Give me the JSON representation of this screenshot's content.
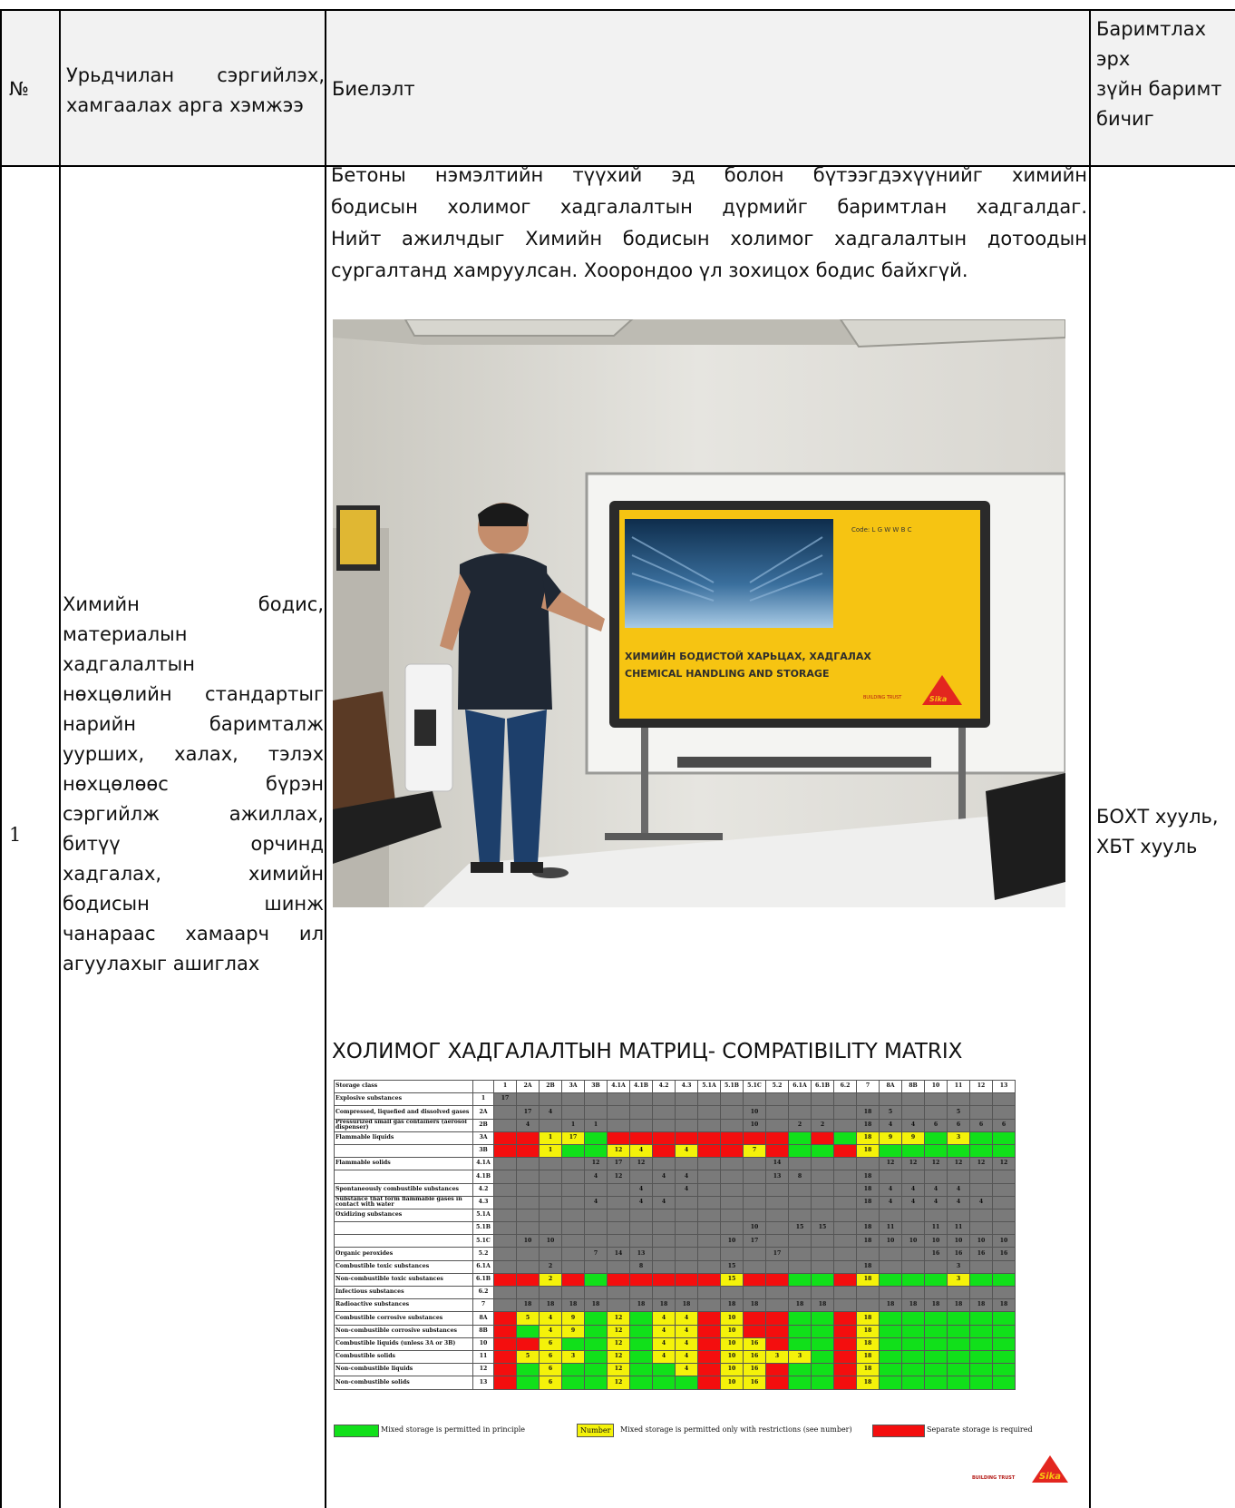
{
  "header": {
    "no": "№",
    "measure": "Урьдчилан сэргийлэх, хамгаалах арга хэмжээ",
    "implementation": "Биелэлт",
    "document_lines": [
      "Баримтлах",
      "эрх",
      "зүйн баримт",
      "бичиг"
    ]
  },
  "row": {
    "no": "1",
    "measure_lines": [
      "Химийн бодис,",
      "материалын",
      "хадгалалтын",
      "нөхцөлийн стандартыг",
      "нарийн баримталж",
      "ууршиx, халах, тэлэх",
      "нөхцөлөөс бүрэн",
      "сэргийлж ажиллах,",
      "битүү орчинд",
      "хадгалах, химийн",
      "бодисын шинж",
      "чанараас хамаарч ил",
      "агуулахыг ашиглах"
    ],
    "implementation_lines": [
      "Бетоны нэмэлтийн түүхий эд болон бүтээгдэхүүнийг химийн",
      "бодисын холимог хадгалалтын дүрмийг баримтлан хадгалдаг.",
      "Нийт ажилчдыг Химийн бодисын холимог хадгалалтын дотоодын",
      "сургалтанд хамруулсан. Хоорондоо үл зохицох бодис байхгүй."
    ],
    "document_lines": [
      "БОХТ хууль,",
      "ХБТ хууль"
    ]
  },
  "photo": {
    "screen_code": "Code: L G W W B C",
    "screen_title_mn": "ХИМИЙН БОДИСТОЙ ХАРЬЦАХ, ХАДГАЛАХ",
    "screen_title_en": "CHEMICAL HANDLING AND STORAGE",
    "screen_brand": "BUILDING TRUST",
    "logo": "Sika"
  },
  "matrix": {
    "caption": "ХОЛИМОГ ХАДГАЛАЛТЫН МАТРИЦ- COMPATIBILITY MATRIX",
    "corner": "Storage class",
    "columns": [
      "1",
      "2A",
      "2B",
      "3A",
      "3B",
      "4.1A",
      "4.1B",
      "4.2",
      "4.3",
      "5.1A",
      "5.1B",
      "5.1C",
      "5.2",
      "6.1A",
      "6.1B",
      "6.2",
      "7",
      "8A",
      "8B",
      "10",
      "11",
      "12",
      "13"
    ],
    "rows": [
      {
        "label": "Explosive substances",
        "cls": "1",
        "cells": [
          "g:17",
          "g",
          "g",
          "g",
          "g",
          "g",
          "g",
          "g",
          "g",
          "g",
          "g",
          "g",
          "g",
          "g",
          "g",
          "g",
          "g",
          "g",
          "g",
          "g",
          "g",
          "g",
          "g"
        ]
      },
      {
        "label": "Compressed, liquefied and dissolved gases",
        "cls": "2A",
        "cells": [
          "g",
          "g:17",
          "g:4",
          "g",
          "g",
          "g",
          "g",
          "g",
          "g",
          "g",
          "g",
          "g:10",
          "g",
          "g",
          "g",
          "g",
          "g:18",
          "g:5",
          "g",
          "g",
          "g:5",
          "g",
          "g"
        ]
      },
      {
        "label": "Pressurized small gas containers (aerosol dispenser)",
        "cls": "2B",
        "cells": [
          "g",
          "g:4",
          "g",
          "g:1",
          "g:1",
          "g",
          "g",
          "g",
          "g",
          "g",
          "g",
          "g:10",
          "g",
          "g:2",
          "g:2",
          "g",
          "g:18",
          "g:4",
          "g:4",
          "g:6",
          "g:6",
          "g:6",
          "g:6"
        ]
      },
      {
        "label": "Flammable liquids",
        "cls": "3A",
        "cells": [
          "re",
          "re",
          "ye:1",
          "ye:17",
          "gr",
          "re",
          "re",
          "re",
          "re",
          "re",
          "re",
          "re",
          "re",
          "gr",
          "re",
          "gr",
          "ye:18",
          "ye:9",
          "ye:9",
          "gr",
          "ye:3",
          "gr",
          "gr"
        ]
      },
      {
        "label": "",
        "cls": "3B",
        "cells": [
          "re",
          "re",
          "ye:1",
          "gr",
          "gr",
          "ye:12",
          "ye:4",
          "re",
          "ye:4",
          "re",
          "re",
          "ye:7",
          "re",
          "gr",
          "gr",
          "re",
          "ye:18",
          "gr",
          "gr",
          "gr",
          "gr",
          "gr",
          "gr"
        ]
      },
      {
        "label": "Flammable solids",
        "cls": "4.1A",
        "cells": [
          "g",
          "g",
          "g",
          "g",
          "g:12",
          "g:17",
          "g:12",
          "g",
          "g",
          "g",
          "g",
          "g",
          "g:14",
          "g",
          "g",
          "g",
          "g",
          "g:12",
          "g:12",
          "g:12",
          "g:12",
          "g:12",
          "g:12"
        ]
      },
      {
        "label": "",
        "cls": "4.1B",
        "cells": [
          "g",
          "g",
          "g",
          "g",
          "g:4",
          "g:12",
          "g",
          "g:4",
          "g:4",
          "g",
          "g",
          "g",
          "g:13",
          "g:8",
          "g",
          "g",
          "g:18",
          "g",
          "g",
          "g",
          "g",
          "g",
          "g"
        ]
      },
      {
        "label": "Spontaneously combustible substances",
        "cls": "4.2",
        "cells": [
          "g",
          "g",
          "g",
          "g",
          "g",
          "g",
          "g:4",
          "g",
          "g:4",
          "g",
          "g",
          "g",
          "g",
          "g",
          "g",
          "g",
          "g:18",
          "g:4",
          "g:4",
          "g:4",
          "g:4",
          "g",
          "g"
        ]
      },
      {
        "label": "Substance that form flammable gases in contact with water",
        "cls": "4.3",
        "cells": [
          "g",
          "g",
          "g",
          "g",
          "g:4",
          "g",
          "g:4",
          "g:4",
          "g",
          "g",
          "g",
          "g",
          "g",
          "g",
          "g",
          "g",
          "g:18",
          "g:4",
          "g:4",
          "g:4",
          "g:4",
          "g:4",
          "g"
        ]
      },
      {
        "label": "Oxidizing substances",
        "cls": "5.1A",
        "cells": [
          "g",
          "g",
          "g",
          "g",
          "g",
          "g",
          "g",
          "g",
          "g",
          "g",
          "g",
          "g",
          "g",
          "g",
          "g",
          "g",
          "g",
          "g",
          "g",
          "g",
          "g",
          "g",
          "g"
        ]
      },
      {
        "label": "",
        "cls": "5.1B",
        "cells": [
          "g",
          "g",
          "g",
          "g",
          "g",
          "g",
          "g",
          "g",
          "g",
          "g",
          "g",
          "g:10",
          "g",
          "g:15",
          "g:15",
          "g",
          "g:18",
          "g:11",
          "g",
          "g:11",
          "g:11",
          "g",
          "g"
        ]
      },
      {
        "label": "",
        "cls": "5.1C",
        "cells": [
          "g",
          "g:10",
          "g:10",
          "g",
          "g",
          "g",
          "g",
          "g",
          "g",
          "g",
          "g:10",
          "g:17",
          "g",
          "g",
          "g",
          "g",
          "g:18",
          "g:10",
          "g:10",
          "g:10",
          "g:10",
          "g:10",
          "g:10"
        ]
      },
      {
        "label": "Organic peroxides",
        "cls": "5.2",
        "cells": [
          "g",
          "g",
          "g",
          "g",
          "g:7",
          "g:14",
          "g:13",
          "g",
          "g",
          "g",
          "g",
          "g",
          "g:17",
          "g",
          "g",
          "g",
          "g",
          "g",
          "g",
          "g:16",
          "g:16",
          "g:16",
          "g:16"
        ]
      },
      {
        "label": "Combustible toxic substances",
        "cls": "6.1A",
        "cells": [
          "g",
          "g",
          "g:2",
          "g",
          "g",
          "g",
          "g:8",
          "g",
          "g",
          "g",
          "g:15",
          "g",
          "g",
          "g",
          "g",
          "g",
          "g:18",
          "g",
          "g",
          "g",
          "g:3",
          "g",
          "g"
        ]
      },
      {
        "label": "Non-combustible toxic substances",
        "cls": "6.1B",
        "cells": [
          "re",
          "re",
          "ye:2",
          "re",
          "gr",
          "re",
          "re",
          "re",
          "re",
          "re",
          "ye:15",
          "re",
          "re",
          "gr",
          "gr",
          "re",
          "ye:18",
          "gr",
          "gr",
          "gr",
          "ye:3",
          "gr",
          "gr"
        ]
      },
      {
        "label": "Infectious substances",
        "cls": "6.2",
        "cells": [
          "g",
          "g",
          "g",
          "g",
          "g",
          "g",
          "g",
          "g",
          "g",
          "g",
          "g",
          "g",
          "g",
          "g",
          "g",
          "g",
          "g",
          "g",
          "g",
          "g",
          "g",
          "g",
          "g"
        ]
      },
      {
        "label": "Radioactive substances",
        "cls": "7",
        "cells": [
          "g",
          "g:18",
          "g:18",
          "g:18",
          "g:18",
          "g",
          "g:18",
          "g:18",
          "g:18",
          "g",
          "g:18",
          "g:18",
          "g",
          "g:18",
          "g:18",
          "g",
          "g",
          "g:18",
          "g:18",
          "g:18",
          "g:18",
          "g:18",
          "g:18"
        ]
      },
      {
        "label": "Combustible corrosive substances",
        "cls": "8A",
        "cells": [
          "re",
          "ye:5",
          "ye:4",
          "ye:9",
          "gr",
          "ye:12",
          "gr",
          "ye:4",
          "ye:4",
          "re",
          "ye:10",
          "re",
          "re",
          "gr",
          "gr",
          "re",
          "ye:18",
          "gr",
          "gr",
          "gr",
          "gr",
          "gr",
          "gr"
        ]
      },
      {
        "label": "Non-combustible corrosive substances",
        "cls": "8B",
        "cells": [
          "re",
          "gr",
          "ye:4",
          "ye:9",
          "gr",
          "ye:12",
          "gr",
          "ye:4",
          "ye:4",
          "re",
          "ye:10",
          "re",
          "re",
          "gr",
          "gr",
          "re",
          "ye:18",
          "gr",
          "gr",
          "gr",
          "gr",
          "gr",
          "gr"
        ]
      },
      {
        "label": "Combustible liquids (unless 3A or 3B)",
        "cls": "10",
        "cells": [
          "re",
          "re",
          "ye:6",
          "gr",
          "gr",
          "ye:12",
          "gr",
          "ye:4",
          "ye:4",
          "re",
          "ye:10",
          "ye:16",
          "re",
          "gr",
          "gr",
          "re",
          "ye:18",
          "gr",
          "gr",
          "gr",
          "gr",
          "gr",
          "gr"
        ]
      },
      {
        "label": "Combustible solids",
        "cls": "11",
        "cells": [
          "re",
          "ye:5",
          "ye:6",
          "ye:3",
          "gr",
          "ye:12",
          "gr",
          "ye:4",
          "ye:4",
          "re",
          "ye:10",
          "ye:16",
          "ye:3",
          "ye:3",
          "gr",
          "re",
          "ye:18",
          "gr",
          "gr",
          "gr",
          "gr",
          "gr",
          "gr"
        ]
      },
      {
        "label": "Non-combustible liquids",
        "cls": "12",
        "cells": [
          "re",
          "gr",
          "ye:6",
          "gr",
          "gr",
          "ye:12",
          "gr",
          "gr",
          "ye:4",
          "re",
          "ye:10",
          "ye:16",
          "re",
          "gr",
          "gr",
          "re",
          "ye:18",
          "gr",
          "gr",
          "gr",
          "gr",
          "gr",
          "gr"
        ]
      },
      {
        "label": "Non-combustible solids",
        "cls": "13",
        "cells": [
          "re",
          "gr",
          "ye:6",
          "gr",
          "gr",
          "ye:12",
          "gr",
          "gr",
          "gr",
          "re",
          "ye:10",
          "ye:16",
          "re",
          "gr",
          "gr",
          "re",
          "ye:18",
          "gr",
          "gr",
          "gr",
          "gr",
          "gr",
          "gr"
        ]
      }
    ],
    "legend": {
      "green": "Mixed storage is permitted in principle",
      "yellow_swatch": "Number",
      "yellow": "Mixed storage is permitted only with restrictions (see number)",
      "red": "Separate storage is required"
    },
    "brand": "BUILDING TRUST",
    "logo": "Sika"
  },
  "colors": {
    "header_bg": "#f2f2f2",
    "matrix_green": "#11e01a",
    "matrix_yellow": "#f4f20a",
    "matrix_red": "#f40e0e",
    "matrix_grey": "#7a7a7a",
    "screen_yellow": "#f6c412",
    "sika_red": "#e3261f"
  }
}
